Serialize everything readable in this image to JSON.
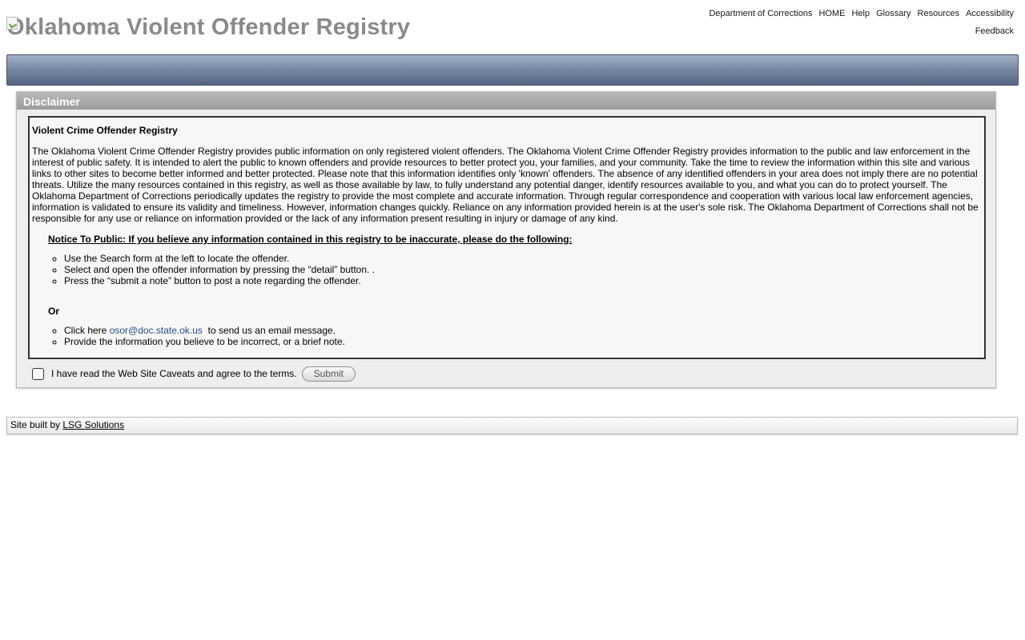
{
  "header": {
    "title": "Oklahoma Violent Offender Registry",
    "nav": [
      "Department of Corrections",
      "HOME",
      "Help",
      "Glossary",
      "Resources",
      "Accessibility"
    ],
    "feedback": "Feedback"
  },
  "panel": {
    "title": "Disclaimer",
    "box_title": "Violent Crime Offender Registry",
    "paragraph": "The Oklahoma Violent Crime Offender Registry provides public information on only registered violent offenders. The Oklahoma Violent Crime Offender Registry provides information to the public and law enforcement in the interest of public safety. It is intended to alert the public to known offenders and provide resources to better protect you, your families, and your community. Take the time to review the information within this site and various links to other sites to become better informed and better protected. Please note that this information identifies only 'known' offenders. The absence of any identified offenders in your area does not imply there are no potential threats. Utilize the many resources contained in this registry, as well as those available by law, to fully understand any potential danger, identify resources available to you, and what you can do to protect yourself. The Oklahoma Department of Corrections periodically updates the registry to provide the most complete and accurate information. Through regular correspondence and cooperation with various local law enforcement agencies, information is validated to ensure its validity and timeliness. However, information changes quickly. Reliance on any information provided herein is at the user's sole risk. The Oklahoma Department of Corrections shall not be responsible for any use or reliance on information provided or the lack of any information present resulting in injury or damage of any kind.",
    "notice_title": "Notice To Public: If you believe any information contained in this registry to be inaccurate, please do the following:",
    "steps": [
      "Use the Search form at the left to locate the offender.",
      "Select and open the offender information by pressing the “detail” button. .",
      "Press the “submit a note” button to post a note regarding the offender."
    ],
    "or_label": "Or",
    "email_prefix": "Click here ",
    "email": "osor@doc.state.ok.us",
    "email_suffix": "  to send us an email message.",
    "last_step": "Provide the information you believe to be incorrect, or a brief note.",
    "agree_label": "I have read the Web Site Caveats and agree to the terms.",
    "submit_label": "Submit"
  },
  "footer": {
    "prefix": "Site built by ",
    "link": "LSG Solutions"
  }
}
